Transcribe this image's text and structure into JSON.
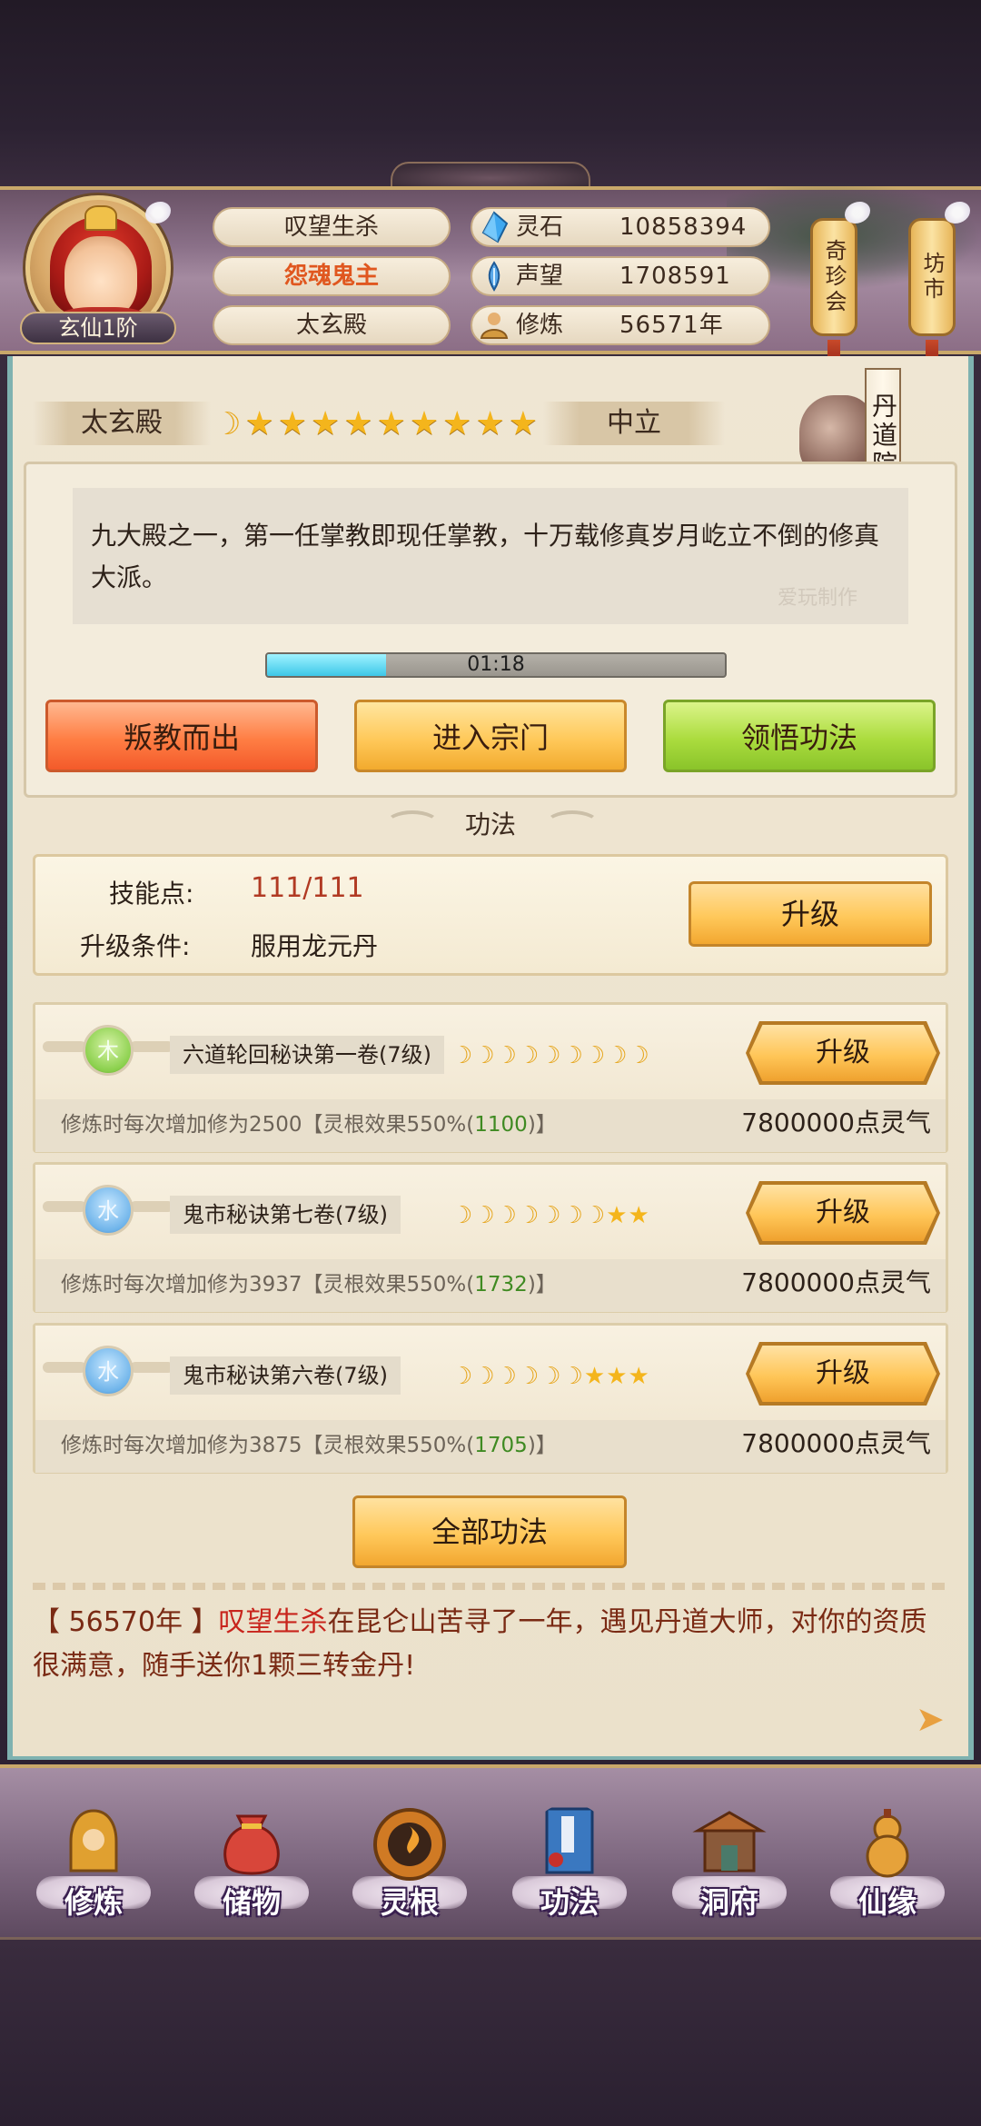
{
  "player": {
    "name": "叹望生杀",
    "title": "怨魂鬼主",
    "sect": "太玄殿",
    "rank": "玄仙1阶"
  },
  "resources": [
    {
      "label": "灵石",
      "value": "10858394",
      "icon": "spirit-stone-icon",
      "color": "#3fa8f0"
    },
    {
      "label": "声望",
      "value": "1708591",
      "icon": "reputation-icon",
      "color": "#5aa8e8"
    },
    {
      "label": "修炼",
      "value": "56571年",
      "icon": "cultivation-icon",
      "color": "#d49a40"
    }
  ],
  "side_buttons": {
    "treasure": "奇珍会",
    "market": "坊市"
  },
  "sect_info": {
    "name": "太玄殿",
    "stance": "中立",
    "stars": 9,
    "location": "丹道院",
    "description": "九大殿之一，第一任掌教即现任掌教，十万载修真岁月屹立不倒的修真大派。",
    "watermark": "爱玩制作",
    "timer": "01:18",
    "timer_progress": 0.26
  },
  "actions": {
    "betray": "叛教而出",
    "enter": "进入宗门",
    "comprehend": "领悟功法"
  },
  "section_title": "功法",
  "skill_points": {
    "label": "技能点:",
    "value": "111/111",
    "condition_label": "升级条件:",
    "condition_value": "服用龙元丹",
    "upgrade": "升级"
  },
  "gongfa": [
    {
      "element": "木",
      "name": "六道轮回秘诀第一卷(7级)",
      "marks": [
        "m",
        "m",
        "m",
        "m",
        "m",
        "m",
        "m",
        "m",
        "m"
      ],
      "effect_prefix": "修炼时每次增加修为2500【灵根效果550%(",
      "effect_bonus": "1100",
      "effect_suffix": ")】",
      "cost": "7800000点灵气",
      "upgrade": "升级"
    },
    {
      "element": "水",
      "name": "鬼市秘诀第七卷(7级)",
      "marks": [
        "m",
        "m",
        "m",
        "m",
        "m",
        "m",
        "m",
        "s",
        "s"
      ],
      "effect_prefix": "修炼时每次增加修为3937【灵根效果550%(",
      "effect_bonus": "1732",
      "effect_suffix": ")】",
      "cost": "7800000点灵气",
      "upgrade": "升级"
    },
    {
      "element": "水",
      "name": "鬼市秘诀第六卷(7级)",
      "marks": [
        "m",
        "m",
        "m",
        "m",
        "m",
        "m",
        "s",
        "s",
        "s"
      ],
      "effect_prefix": "修炼时每次增加修为3875【灵根效果550%(",
      "effect_bonus": "1705",
      "effect_suffix": ")】",
      "cost": "7800000点灵气",
      "upgrade": "升级"
    }
  ],
  "all_gongfa": "全部功法",
  "log": {
    "year": "【 56570年 】",
    "name": "叹望生杀",
    "text": "在昆仑山苦寻了一年，遇见丹道大师，对你的资质很满意，随手送你1颗三转金丹!"
  },
  "nav": [
    {
      "label": "修炼",
      "icon": "cultivate-icon",
      "color": "#e0a030"
    },
    {
      "label": "储物",
      "icon": "storage-bag-icon",
      "color": "#d8463a"
    },
    {
      "label": "灵根",
      "icon": "spirit-root-icon",
      "color": "#d07a24"
    },
    {
      "label": "功法",
      "icon": "technique-book-icon",
      "color": "#3a78c0"
    },
    {
      "label": "洞府",
      "icon": "cave-house-icon",
      "color": "#b86a30"
    },
    {
      "label": "仙缘",
      "icon": "gourd-icon",
      "color": "#e6a23a"
    }
  ]
}
